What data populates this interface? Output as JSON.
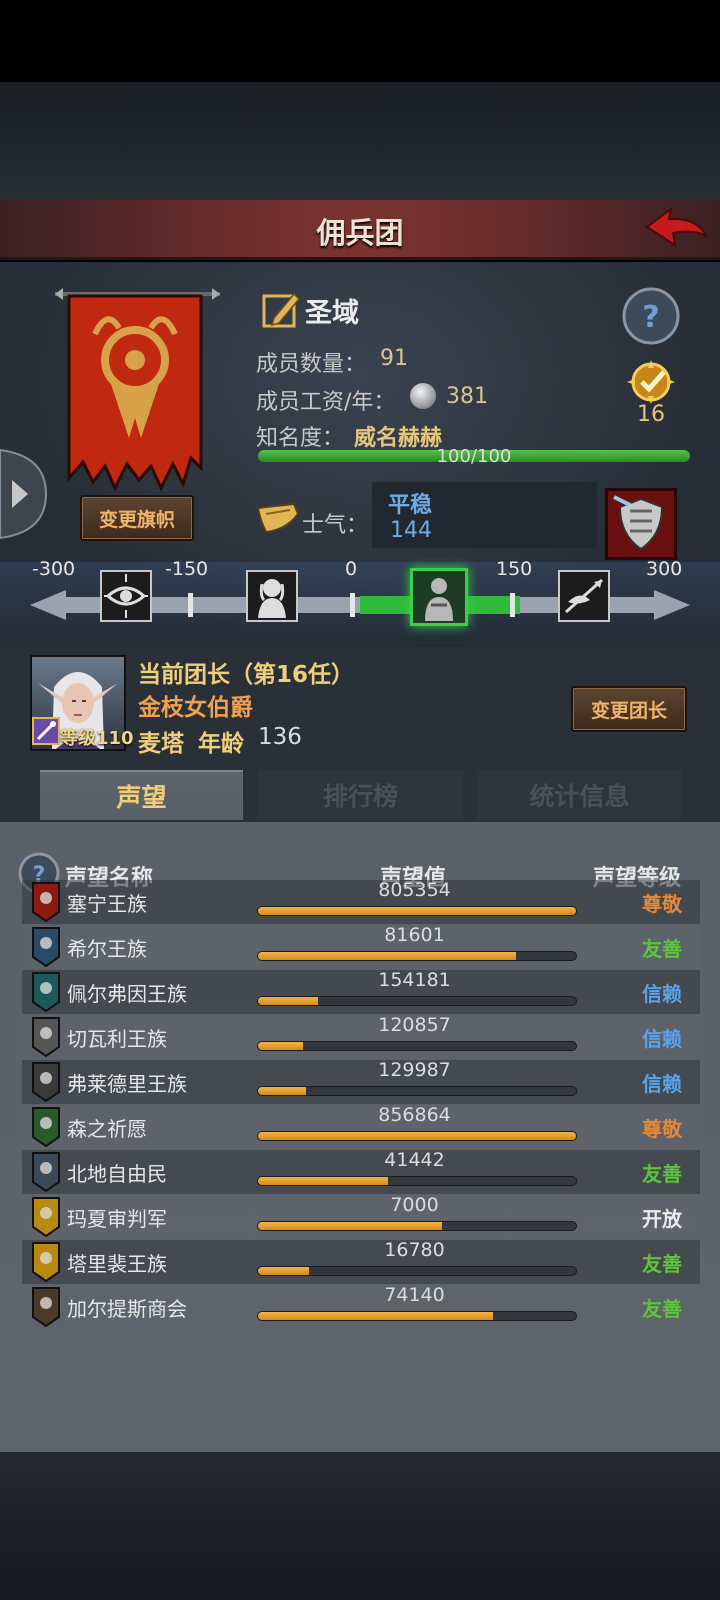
{
  "header": {
    "title": "佣兵团"
  },
  "guild": {
    "name": "圣域",
    "member_count_label": "成员数量：",
    "member_count": "91",
    "salary_label": "成员工资/年：",
    "salary": "381",
    "fame_label": "知名度：",
    "fame_value": "威名赫赫",
    "fame_progress_text": "100/100",
    "fame_progress": 1.0,
    "badge_count": "16",
    "change_banner_label": "变更旗帜"
  },
  "morale": {
    "label": "士气：",
    "state": "平稳",
    "value": "144"
  },
  "morale_scale": {
    "ticks": [
      "-300",
      "-150",
      "0",
      "150",
      "300"
    ],
    "active_range": [
      0,
      150
    ]
  },
  "leader": {
    "title": "当前团长（第16任）",
    "name": "金枝女伯爵",
    "level_text": "等级110",
    "race": "麦塔",
    "age_label": "年龄",
    "age": "136",
    "change_leader_label": "变更团长"
  },
  "tabs": [
    {
      "label": "声望",
      "active": true
    },
    {
      "label": "排行榜",
      "active": false
    },
    {
      "label": "统计信息",
      "active": false
    }
  ],
  "list_header": {
    "name": "声望名称",
    "value": "声望值",
    "level": "声望等级"
  },
  "reputation": [
    {
      "name": "塞宁王族",
      "value": "805354",
      "fill": 1.0,
      "level": "尊敬",
      "level_color": "#e0893a",
      "icon": "red-shield-icon"
    },
    {
      "name": "希尔王族",
      "value": "81601",
      "fill": 0.81,
      "level": "友善",
      "level_color": "#5fc43a",
      "icon": "blue-skull-shield-icon"
    },
    {
      "name": "佩尔弗因王族",
      "value": "154181",
      "fill": 0.19,
      "level": "信赖",
      "level_color": "#5aa2ea",
      "icon": "teal-crescent-shield-icon"
    },
    {
      "name": "切瓦利王族",
      "value": "120857",
      "fill": 0.14,
      "level": "信赖",
      "level_color": "#5aa2ea",
      "icon": "scales-shield-icon"
    },
    {
      "name": "弗莱德里王族",
      "value": "129987",
      "fill": 0.15,
      "level": "信赖",
      "level_color": "#5aa2ea",
      "icon": "dark-horse-shield-icon"
    },
    {
      "name": "森之祈愿",
      "value": "856864",
      "fill": 1.0,
      "level": "尊敬",
      "level_color": "#e0893a",
      "icon": "tree-shield-icon"
    },
    {
      "name": "北地自由民",
      "value": "41442",
      "fill": 0.41,
      "level": "友善",
      "level_color": "#5fc43a",
      "icon": "axe-shield-icon"
    },
    {
      "name": "玛夏审判军",
      "value": "7000",
      "fill": 0.58,
      "level": "开放",
      "level_color": "#ececec",
      "icon": "yellow-cross-shield-icon"
    },
    {
      "name": "塔里裴王族",
      "value": "16780",
      "fill": 0.16,
      "level": "友善",
      "level_color": "#5fc43a",
      "icon": "yellow-crown-shield-icon"
    },
    {
      "name": "加尔提斯商会",
      "value": "74140",
      "fill": 0.74,
      "level": "友善",
      "level_color": "#5fc43a",
      "icon": "chest-shield-icon"
    }
  ]
}
